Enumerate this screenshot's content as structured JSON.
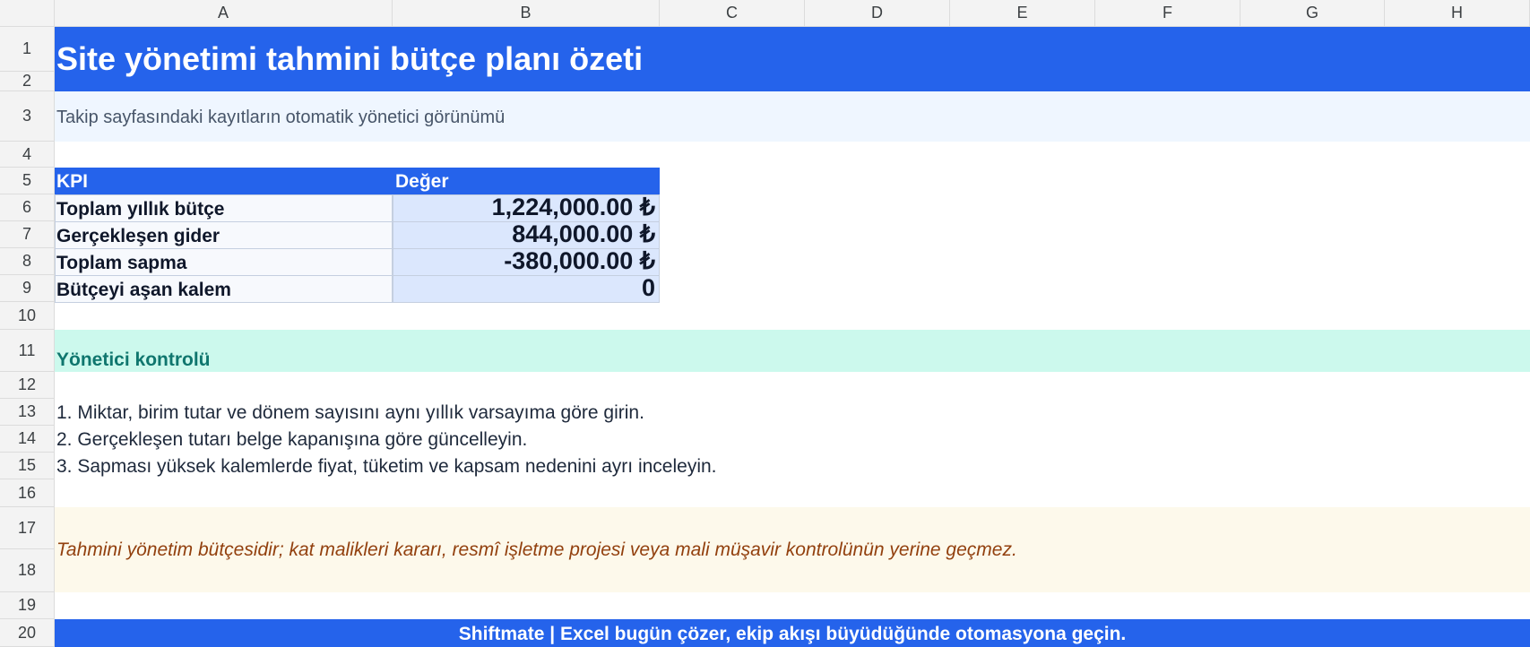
{
  "sheet": {
    "columns": [
      "A",
      "B",
      "C",
      "D",
      "E",
      "F",
      "G",
      "H"
    ],
    "rows": [
      "1",
      "2",
      "3",
      "4",
      "5",
      "6",
      "7",
      "8",
      "9",
      "10",
      "11",
      "12",
      "13",
      "14",
      "15",
      "16",
      "17",
      "18",
      "19",
      "20"
    ]
  },
  "title": "Site yönetimi tahmini bütçe planı özeti",
  "subtitle": "Takip sayfasındaki kayıtların otomatik yönetici görünümü",
  "kpi_table": {
    "header_kpi": "KPI",
    "header_value": "Değer",
    "rows": [
      {
        "label": "Toplam yıllık bütçe",
        "value": "1,224,000.00 ₺"
      },
      {
        "label": "Gerçekleşen gider",
        "value": "844,000.00 ₺"
      },
      {
        "label": "Toplam sapma",
        "value": "-380,000.00 ₺"
      },
      {
        "label": "Bütçeyi aşan kalem",
        "value": "0"
      }
    ]
  },
  "section_title": "Yönetici kontrolü",
  "steps": [
    "1. Miktar, birim tutar ve dönem sayısını aynı yıllık varsayıma göre girin.",
    "2. Gerçekleşen tutarı belge kapanışına göre güncelleyin.",
    "3. Sapması yüksek kalemlerde fiyat, tüketim ve kapsam nedenini ayrı inceleyin."
  ],
  "disclaimer": "Tahmini yönetim bütçesidir; kat malikleri kararı, resmî işletme projesi veya mali müşavir kontrolünün yerine geçmez.",
  "footer": "Shiftmate | Excel bugün çözer, ekip akışı büyüdüğünde otomasyona geçin.",
  "colors": {
    "title_bg": "#2563eb",
    "subtitle_bg": "#eff6ff",
    "section_bg": "#ccf9ed",
    "section_text": "#0f766e",
    "disclaimer_bg": "#fdf9eb",
    "disclaimer_text": "#92400e",
    "value_cell_bg": "#dbe7fd"
  }
}
